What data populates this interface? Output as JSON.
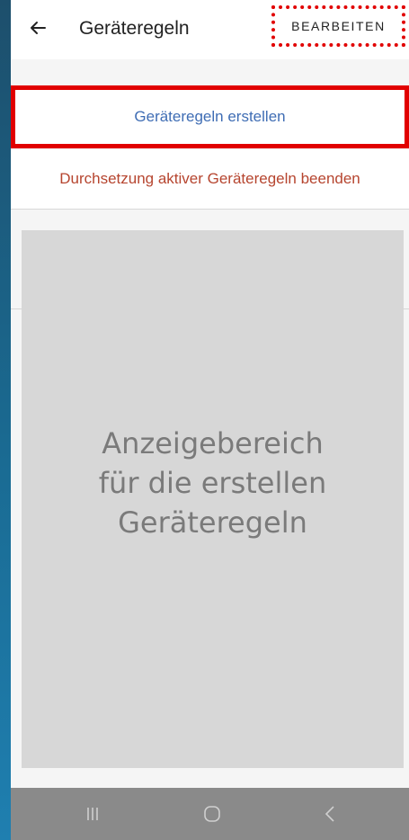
{
  "appbar": {
    "title": "Geräteregeln",
    "edit_label": "BEARBEITEN",
    "back_icon": "arrow-left-icon"
  },
  "options": {
    "create_label": "Geräteregeln erstellen",
    "stop_label": "Durchsetzung aktiver Geräteregeln beenden"
  },
  "placeholder": {
    "text": "Anzeigebereich\nfür die erstellen\nGeräteregeln"
  },
  "navbar": {
    "recent_icon": "recent-apps-icon",
    "home_icon": "home-icon",
    "back_icon": "nav-back-icon"
  },
  "colors": {
    "highlight": "#e10000",
    "link_blue": "#3f6db4",
    "warning_red": "#b6452f"
  }
}
